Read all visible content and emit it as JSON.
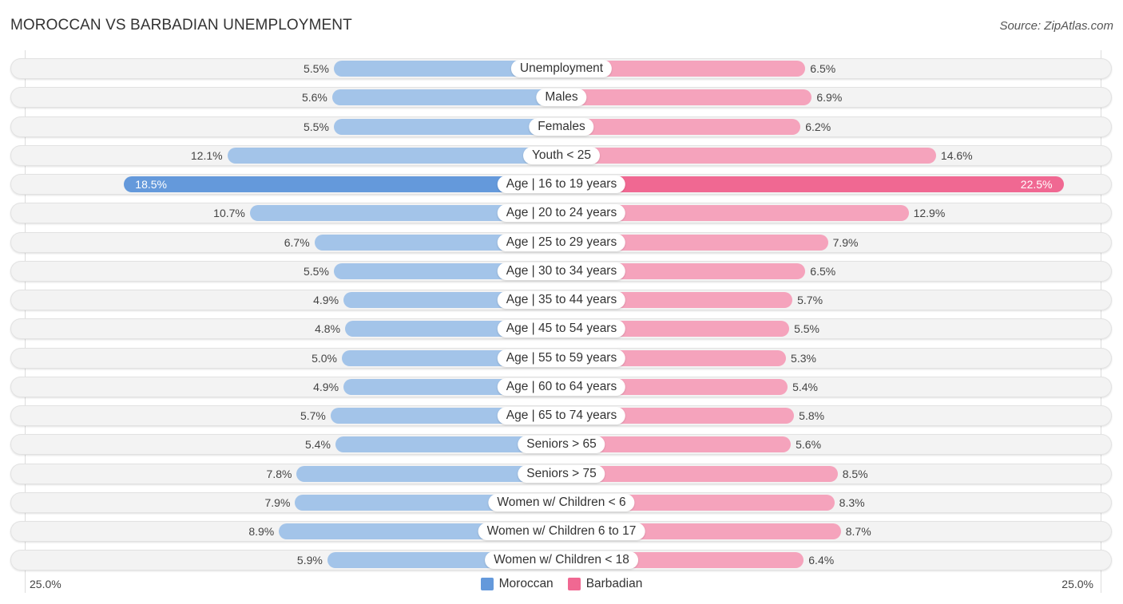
{
  "header": {
    "title": "MOROCCAN VS BARBADIAN UNEMPLOYMENT",
    "source": "Source: ZipAtlas.com"
  },
  "colors": {
    "moroccan": "#a3c4e9",
    "moroccan_highlight": "#6499db",
    "barbadian": "#f5a3bc",
    "barbadian_highlight": "#f06892",
    "legend_moroccan": "#6499db",
    "legend_barbadian": "#f06892"
  },
  "chart_data": {
    "type": "bar",
    "orientation": "horizontal-diverging",
    "title": "MOROCCAN VS BARBADIAN UNEMPLOYMENT",
    "categories": [
      "Unemployment",
      "Males",
      "Females",
      "Youth < 25",
      "Age | 16 to 19 years",
      "Age | 20 to 24 years",
      "Age | 25 to 29 years",
      "Age | 30 to 34 years",
      "Age | 35 to 44 years",
      "Age | 45 to 54 years",
      "Age | 55 to 59 years",
      "Age | 60 to 64 years",
      "Age | 65 to 74 years",
      "Seniors > 65",
      "Seniors > 75",
      "Women w/ Children < 6",
      "Women w/ Children 6 to 17",
      "Women w/ Children < 18"
    ],
    "series": [
      {
        "name": "Moroccan",
        "side": "left",
        "values": [
          5.5,
          5.6,
          5.5,
          12.1,
          18.5,
          10.7,
          6.7,
          5.5,
          4.9,
          4.8,
          5.0,
          4.9,
          5.7,
          5.4,
          7.8,
          7.9,
          8.9,
          5.9
        ],
        "labels": [
          "5.5%",
          "5.6%",
          "5.5%",
          "12.1%",
          "18.5%",
          "10.7%",
          "6.7%",
          "5.5%",
          "4.9%",
          "4.8%",
          "5.0%",
          "4.9%",
          "5.7%",
          "5.4%",
          "7.8%",
          "7.9%",
          "8.9%",
          "5.9%"
        ]
      },
      {
        "name": "Barbadian",
        "side": "right",
        "values": [
          6.5,
          6.9,
          6.2,
          14.6,
          22.5,
          12.9,
          7.9,
          6.5,
          5.7,
          5.5,
          5.3,
          5.4,
          5.8,
          5.6,
          8.5,
          8.3,
          8.7,
          6.4
        ],
        "labels": [
          "6.5%",
          "6.9%",
          "6.2%",
          "14.6%",
          "22.5%",
          "12.9%",
          "7.9%",
          "6.5%",
          "5.7%",
          "5.5%",
          "5.3%",
          "5.4%",
          "5.8%",
          "5.6%",
          "8.5%",
          "8.3%",
          "8.7%",
          "6.4%"
        ]
      }
    ],
    "highlighted_category": "Age | 16 to 19 years",
    "axis": {
      "min_label": "25.0%",
      "max_label": "25.0%",
      "range": [
        0,
        25
      ]
    },
    "legend": {
      "position": "bottom-center",
      "entries": [
        "Moroccan",
        "Barbadian"
      ]
    },
    "xlabel": "",
    "ylabel": ""
  }
}
